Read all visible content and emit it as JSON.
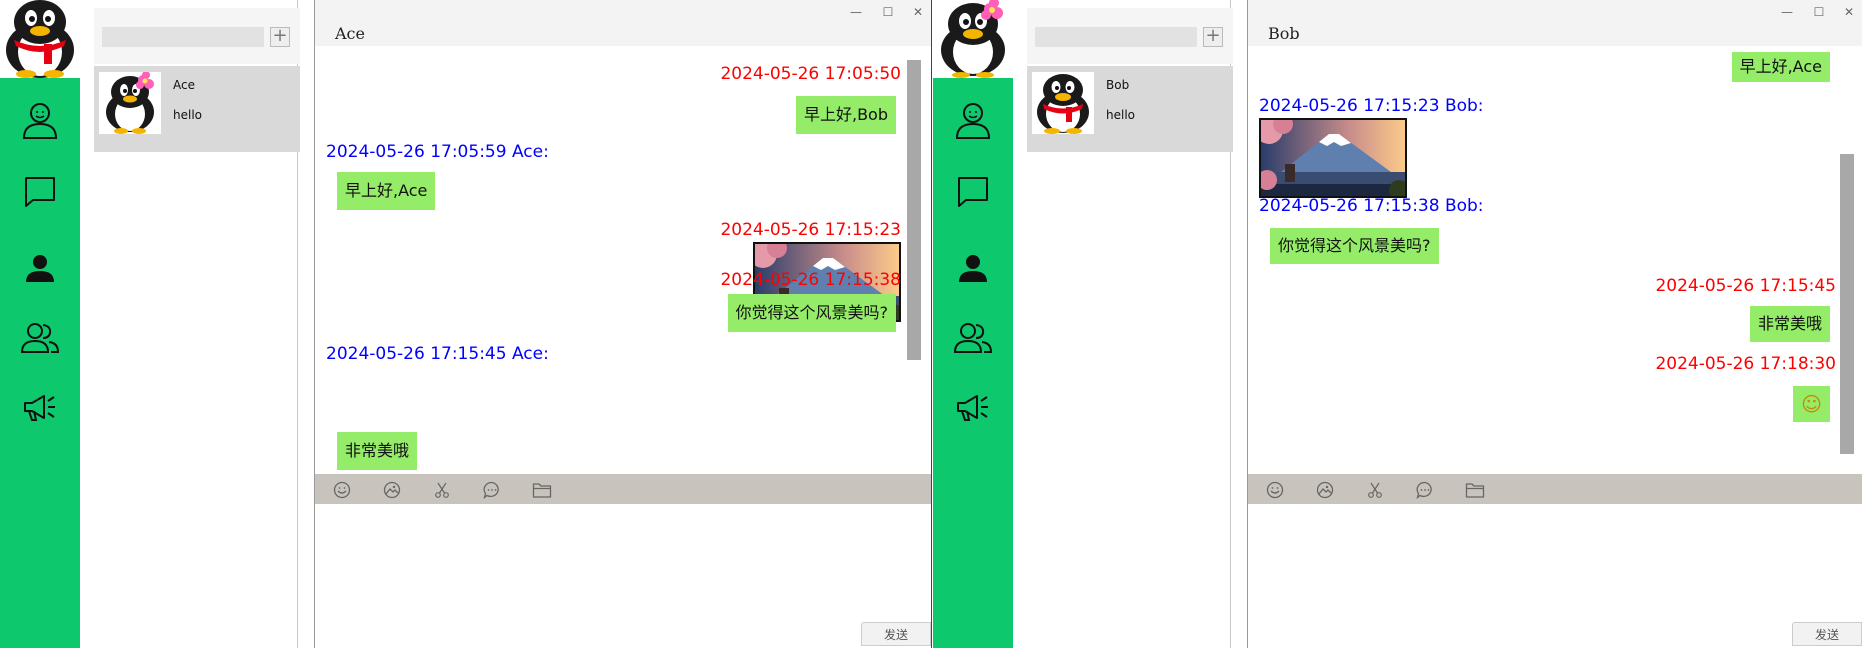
{
  "left": {
    "search": {
      "placeholder": "",
      "add_label": "+"
    },
    "contact": {
      "name": "Ace",
      "last_message": "hello"
    },
    "chat": {
      "title": "Ace",
      "messages": [
        {
          "time": "2024-05-26 17:05:50",
          "text": "早上好,Bob"
        },
        {
          "time": "2024-05-26 17:05:59  Ace:",
          "text": "早上好,Ace"
        },
        {
          "time": "2024-05-26 17:15:23"
        },
        {
          "time": "2024-05-26 17:15:38",
          "text": "你觉得这个风景美吗?"
        },
        {
          "time": "2024-05-26 17:15:45  Ace:",
          "text": "非常美哦"
        }
      ],
      "send_label": "发送"
    }
  },
  "right": {
    "search": {
      "placeholder": "",
      "add_label": "+"
    },
    "contact": {
      "name": "Bob",
      "last_message": "hello"
    },
    "chat": {
      "title": "Bob",
      "messages": [
        {
          "text": "早上好,Ace"
        },
        {
          "time": "2024-05-26 17:15:23  Bob:"
        },
        {
          "time": "2024-05-26 17:15:38  Bob:",
          "text": "你觉得这个风景美吗?"
        },
        {
          "time": "2024-05-26 17:15:45",
          "text": "非常美哦"
        },
        {
          "time": "2024-05-26 17:18:30",
          "emoji": "☺"
        }
      ],
      "send_label": "发送"
    }
  },
  "window_controls": {
    "minimize": "—",
    "maximize": "☐",
    "close": "✕"
  },
  "colors": {
    "nav": "#0ec86d",
    "bubble": "#95ec69",
    "own_time": "#ff0000",
    "peer_time": "#0000ff",
    "toolbar": "#c8c4bd"
  },
  "nav_icons": [
    "user-outline-icon",
    "chat-icon",
    "user-filled-icon",
    "group-icon",
    "megaphone-icon"
  ],
  "toolbar_icons": [
    "emoji-icon",
    "image-icon",
    "scissors-icon",
    "chat-bubble-icon",
    "folder-icon"
  ]
}
